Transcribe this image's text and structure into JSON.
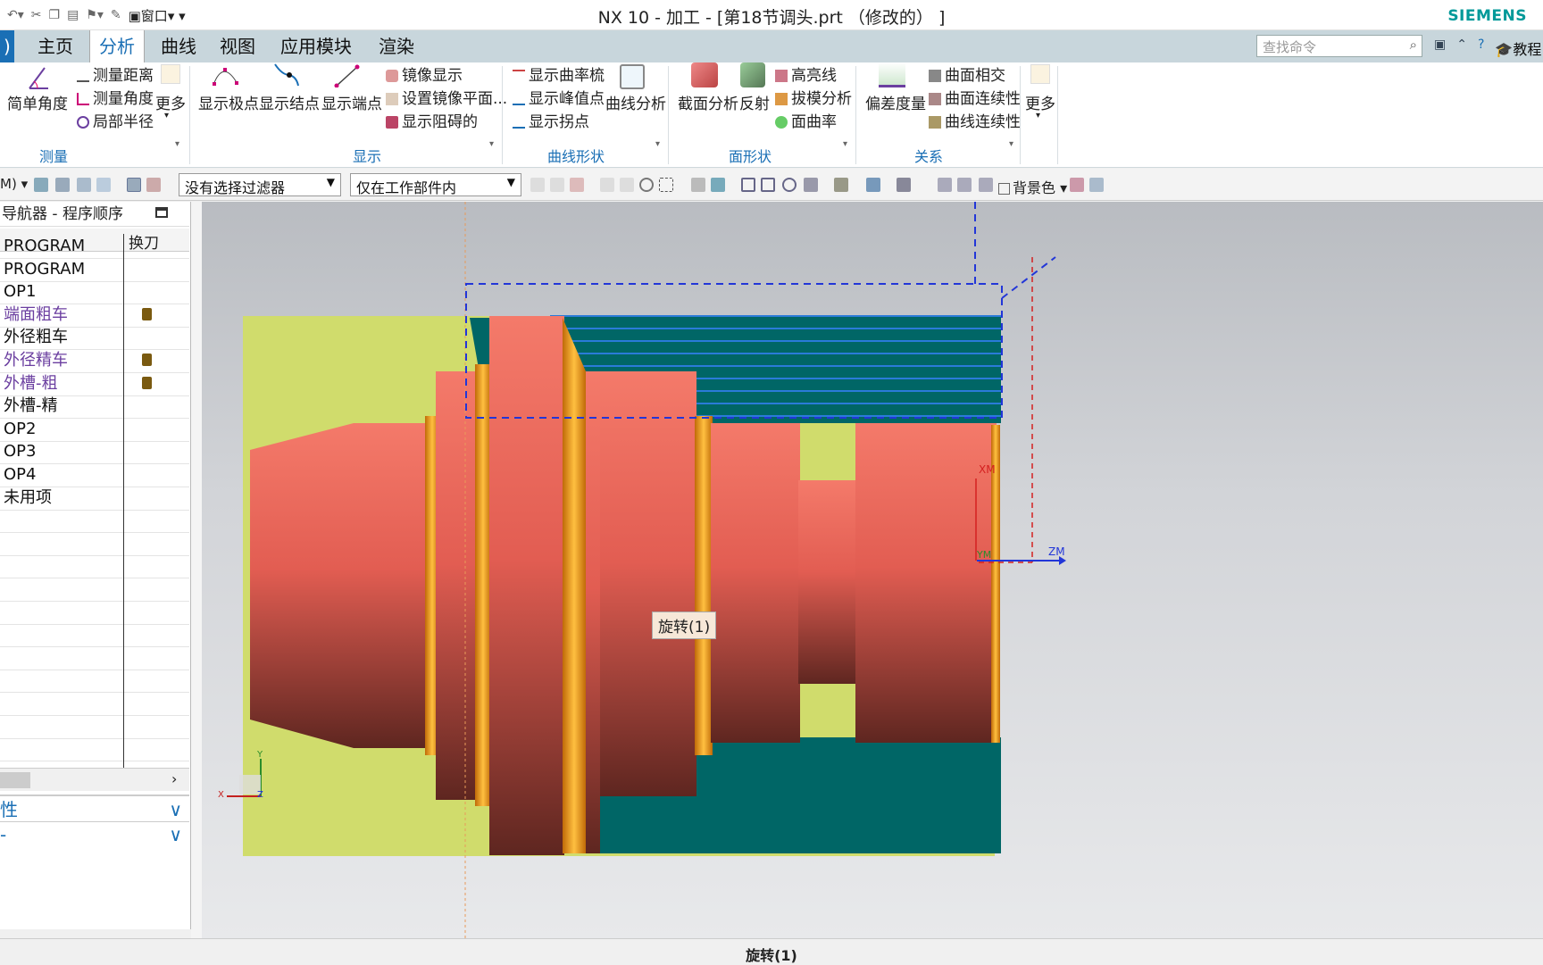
{
  "window": {
    "title": "NX 10 - 加工 - [第18节调头.prt （修改的） ]",
    "brand": "SIEMENS",
    "window_menu": "窗口"
  },
  "menubar": {
    "tabs": [
      {
        "label": ")"
      },
      {
        "label": "主页"
      },
      {
        "label": "分析",
        "active": true
      },
      {
        "label": "曲线"
      },
      {
        "label": "视图"
      },
      {
        "label": "应用模块"
      },
      {
        "label": "渲染"
      }
    ],
    "search_placeholder": "查找命令",
    "tutorial": "教程"
  },
  "ribbon": {
    "measure": {
      "simple_angle": "简单角度",
      "measure_distance": "测量距离",
      "measure_angle": "测量角度",
      "local_radius": "局部半径",
      "more": "更多",
      "group": "测量"
    },
    "display": {
      "show_poles": "显示极点",
      "show_knots": "显示结点",
      "show_endpoints": "显示端点",
      "mirror_display": "镜像显示",
      "set_mirror_plane": "设置镜像平面...",
      "show_blocking": "显示阻碍的",
      "group": "显示"
    },
    "curve_shape": {
      "show_curvature_comb": "显示曲率梳",
      "show_peak_points": "显示峰值点",
      "show_inflections": "显示拐点",
      "curve_analysis": "曲线分析",
      "group": "曲线形状"
    },
    "face_shape": {
      "section_analysis": "截面分析",
      "reflection": "反射",
      "highlight_lines": "高亮线",
      "draft_analysis": "拔模分析",
      "face_curvature": "面曲率",
      "group": "面形状"
    },
    "relation": {
      "deviation_gauge": "偏差度量",
      "face_intersection": "曲面相交",
      "face_continuity": "曲面连续性",
      "curve_continuity": "曲线连续性",
      "group": "关系",
      "more": "更多"
    }
  },
  "toolbar": {
    "menu_short": "M)",
    "filter": "没有选择过滤器",
    "scope": "仅在工作部件内",
    "background": "背景色"
  },
  "navigator": {
    "title": "导航器 - 程序顺序",
    "col_tool_change": "换刀",
    "items": [
      {
        "label": "PROGRAM",
        "lock": false,
        "color": "#111"
      },
      {
        "label": "PROGRAM",
        "lock": false,
        "color": "#111"
      },
      {
        "label": "OP1",
        "lock": false,
        "color": "#111"
      },
      {
        "label": "端面粗车",
        "lock": true,
        "color": "#6b3fa0"
      },
      {
        "label": "外径粗车",
        "lock": false,
        "color": "#111"
      },
      {
        "label": "外径精车",
        "lock": true,
        "color": "#6b3fa0"
      },
      {
        "label": "外槽-粗",
        "lock": true,
        "color": "#6b3fa0"
      },
      {
        "label": "外槽-精",
        "lock": false,
        "color": "#111"
      },
      {
        "label": "OP2",
        "lock": false,
        "color": "#111"
      },
      {
        "label": "OP3",
        "lock": false,
        "color": "#111"
      },
      {
        "label": "OP4",
        "lock": false,
        "color": "#111"
      },
      {
        "label": "未用项",
        "lock": false,
        "color": "#111"
      }
    ],
    "panel_property": "性",
    "panel_other": "-"
  },
  "viewport": {
    "tooltip": "旋转(1)",
    "axis_xm": "XM",
    "axis_ym": "YM",
    "axis_zm": "ZM",
    "triad_x": "X",
    "triad_y": "Y",
    "triad_z": "Z"
  },
  "status": {
    "text": "旋转(1)"
  },
  "colors": {
    "part_red": "#f07060",
    "part_orange": "#f0a020",
    "stock_teal": "#006666",
    "stock_yellow": "#d0dc6c",
    "accent": "#1a6fb5",
    "brand": "#009999"
  }
}
